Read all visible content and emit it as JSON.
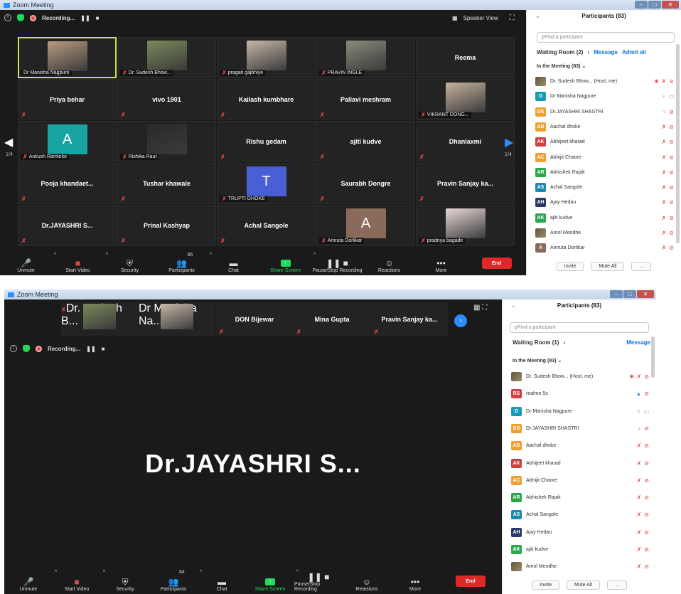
{
  "window_title": "Zoom Meeting",
  "colors": {
    "accent": "#2d8cff",
    "danger": "#e02828",
    "green": "#23d959",
    "active_speaker": "#c8e34a"
  },
  "top": {
    "recording_label": "Recording...",
    "speaker_view_label": "Speaker View",
    "gallery": {
      "tiles": [
        {
          "name": "Dr Manisha Nagpure",
          "label_only": true,
          "photo": true,
          "active": true
        },
        {
          "name": "Dr. Sudesh Bhow...",
          "photo": true,
          "muted": true
        },
        {
          "name": "pragati gajbhiye",
          "photo": true,
          "muted": true
        },
        {
          "name": "PRAVIN INGLE",
          "photo": true,
          "muted": true
        },
        {
          "name": "Reema",
          "center": true
        },
        {
          "name": "Priya behar",
          "center": true,
          "muted": true
        },
        {
          "name": "vivo 1901",
          "center": true,
          "muted": true
        },
        {
          "name": "Kailash kumbhare",
          "center": true,
          "muted": true
        },
        {
          "name": "Pallavi meshram",
          "center": true,
          "muted": true
        },
        {
          "name": "VIKRANT DONG...",
          "photo": true,
          "muted": true
        },
        {
          "name": "Ankush Ramteke",
          "avatar": "A",
          "avatar_color": "#1aa3a3",
          "muted": true
        },
        {
          "name": "Rishika Raut",
          "photo": true,
          "muted": true
        },
        {
          "name": "Rishu gedam",
          "center": true,
          "muted": true
        },
        {
          "name": "ajiti kudve",
          "center": true,
          "muted": true
        },
        {
          "name": "Dhanlaxmi",
          "center": true,
          "muted": true
        },
        {
          "name": "Pooja khandaet...",
          "center": true,
          "muted": true
        },
        {
          "name": "Tushar khawale",
          "center": true,
          "muted": true
        },
        {
          "name": "TRUPTI DHOKE",
          "avatar": "T",
          "avatar_color": "#4a5ed6",
          "muted": true
        },
        {
          "name": "Saurabh Dongre",
          "center": true,
          "muted": true
        },
        {
          "name": "Pravin Sanjay ka...",
          "center": true,
          "muted": true
        },
        {
          "name": "Dr.JAYASHRI S...",
          "center": true,
          "muted": true
        },
        {
          "name": "Prinal Kashyap",
          "center": true,
          "muted": true
        },
        {
          "name": "Achal Sangole",
          "center": true,
          "muted": true
        },
        {
          "name": "Amruta Dorlikar",
          "avatar": "A",
          "avatar_color": "#8a6a5a",
          "muted": true
        },
        {
          "name": "pradnya bagade",
          "photo": true,
          "muted": true
        }
      ],
      "page_left": "1/4",
      "page_right": "1/4"
    },
    "toolbar": {
      "unmute": "Unmute",
      "start_video": "Start Video",
      "security": "Security",
      "participants": "Participants",
      "participants_count": "85",
      "chat": "Chat",
      "share_screen": "Share Screen",
      "pause_recording": "Pause/Stop Recording",
      "reactions": "Reactions",
      "more": "More",
      "end": "End"
    },
    "panel": {
      "title": "Participants (83)",
      "search_placeholder": "Find a participant",
      "waiting_room": "Waiting Room (2)",
      "message": "Message",
      "admit_all": "Admit all",
      "in_meeting": "In the Meeting (83)",
      "participants": [
        {
          "initials": "",
          "color": "",
          "name": "Dr. Sudesh Bhow... (Host, me)",
          "mic": "off",
          "video": "off",
          "recording": true
        },
        {
          "initials": "D",
          "color": "#1a9bb5",
          "name": "Dr Manisha Nagpure",
          "mic": "on",
          "video": "on"
        },
        {
          "initials": "DS",
          "color": "#f0a030",
          "name": "Dr.JAYASHRI SHASTRI",
          "mic": "on",
          "video": "off"
        },
        {
          "initials": "AD",
          "color": "#f0a030",
          "name": "Aachal dhoke",
          "mic": "off",
          "video": "off"
        },
        {
          "initials": "AK",
          "color": "#d04040",
          "name": "Abhijeet kharad",
          "mic": "off",
          "video": "off"
        },
        {
          "initials": "AC",
          "color": "#f0a030",
          "name": "Abhijit Chaore",
          "mic": "off",
          "video": "off"
        },
        {
          "initials": "AR",
          "color": "#2aa84a",
          "name": "Abhishek Rajak",
          "mic": "off",
          "video": "off"
        },
        {
          "initials": "AS",
          "color": "#1a8ab0",
          "name": "Achal Sangole",
          "mic": "off",
          "video": "off"
        },
        {
          "initials": "AH",
          "color": "#2a3a6a",
          "name": "Ajay Hedau",
          "mic": "off",
          "video": "off"
        },
        {
          "initials": "AK",
          "color": "#2aa84a",
          "name": "ajiti kudve",
          "mic": "off",
          "video": "off"
        },
        {
          "initials": "",
          "color": "",
          "name": "Amol Mendhe",
          "mic": "off",
          "video": "off"
        },
        {
          "initials": "A",
          "color": "#8a6a5a",
          "name": "Amruta Dorlikar",
          "mic": "off",
          "video": "off"
        }
      ],
      "invite": "Invite",
      "mute_all": "Mute All",
      "more_dots": "..."
    }
  },
  "bottom": {
    "recording_label": "Recording...",
    "strip": [
      {
        "name": "Dr. Sudesh B...",
        "photo": true,
        "muted": true
      },
      {
        "name": "Dr Manisha Na...",
        "photo": true
      },
      {
        "name": "DON Bijewar",
        "center": true,
        "muted": true
      },
      {
        "name": "Mina Gupta",
        "center": true,
        "muted": true
      },
      {
        "name": "Pravin Sanjay ka...",
        "center": true,
        "muted": true
      }
    ],
    "speaker_name": "Dr.JAYASHRI S...",
    "toolbar": {
      "unmute": "Unmute",
      "start_video": "Start Video",
      "security": "Security",
      "participants": "Participants",
      "participants_count": "84",
      "chat": "Chat",
      "share_screen": "Share Screen",
      "pause_recording": "Pause/Stop Recording",
      "reactions": "Reactions",
      "more": "More",
      "end": "End"
    },
    "panel": {
      "title": "Participants (83)",
      "search_placeholder": "Find a participant",
      "waiting_room": "Waiting Room (1)",
      "message": "Message",
      "in_meeting": "In the Meeting (83)",
      "participants": [
        {
          "initials": "",
          "color": "",
          "name": "Dr. Sudesh Bhow... (Host, me)",
          "mic": "off",
          "video": "off",
          "recording": true
        },
        {
          "initials": "RS",
          "color": "#d04040",
          "name": "realme 5s",
          "mic": "talk",
          "video": "off"
        },
        {
          "initials": "D",
          "color": "#1a9bb5",
          "name": "Dr Manisha Nagpure",
          "mic": "on",
          "video": "on"
        },
        {
          "initials": "DS",
          "color": "#f0a030",
          "name": "Dr.JAYASHRI SHASTRI",
          "mic": "on",
          "video": "off"
        },
        {
          "initials": "AD",
          "color": "#f0a030",
          "name": "Aachal dhoke",
          "mic": "off",
          "video": "off"
        },
        {
          "initials": "AK",
          "color": "#d04040",
          "name": "Abhijeet kharad",
          "mic": "off",
          "video": "off"
        },
        {
          "initials": "AC",
          "color": "#f0a030",
          "name": "Abhijit Chaore",
          "mic": "off",
          "video": "off"
        },
        {
          "initials": "AR",
          "color": "#2aa84a",
          "name": "Abhishek Rajak",
          "mic": "off",
          "video": "off"
        },
        {
          "initials": "AS",
          "color": "#1a8ab0",
          "name": "Achal Sangole",
          "mic": "off",
          "video": "off"
        },
        {
          "initials": "AH",
          "color": "#2a3a6a",
          "name": "Ajay Hedau",
          "mic": "off",
          "video": "off"
        },
        {
          "initials": "AK",
          "color": "#2aa84a",
          "name": "ajiti kudve",
          "mic": "off",
          "video": "off"
        },
        {
          "initials": "",
          "color": "",
          "name": "Amol Mendhe",
          "mic": "off",
          "video": "off"
        }
      ],
      "invite": "Invite",
      "mute_all": "Mute All",
      "more_dots": "..."
    }
  }
}
